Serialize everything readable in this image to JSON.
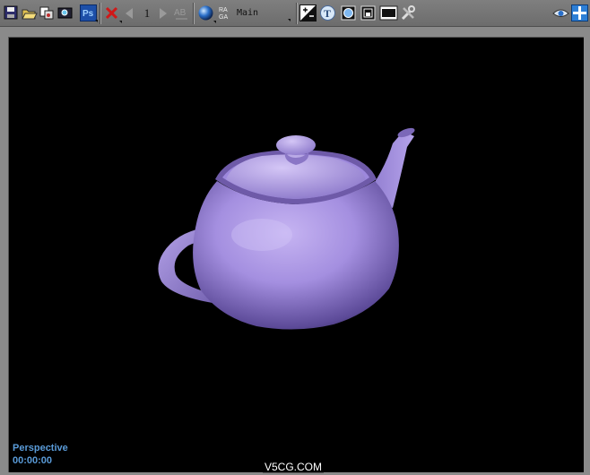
{
  "toolbar": {
    "frame_number": "1",
    "channel": "Main",
    "icons": [
      "save-icon",
      "open-icon",
      "copy-image-icon",
      "clone-frame-icon",
      "photoshop-icon",
      "clear-icon",
      "previous-frame-icon",
      "next-frame-icon",
      "ab-compare-icon",
      "sphere-channel-icon",
      "rgb-alpha-icon",
      "exposure-icon",
      "text-overlay-icon",
      "region-render-icon",
      "safe-frame-icon",
      "display-toggle-icon",
      "tools-icon",
      "view-eye-icon",
      "navigate-icon"
    ]
  },
  "viewport": {
    "view_label": "Perspective",
    "timecode": "00:00:00",
    "watermark": "V5CG.COM",
    "teapot_color": "#a48fe0",
    "background": "#000000"
  },
  "colors": {
    "hud_text": "#5a9bd8",
    "toolbar_bg": "#767676",
    "frame_bg": "#8a8a8a"
  }
}
